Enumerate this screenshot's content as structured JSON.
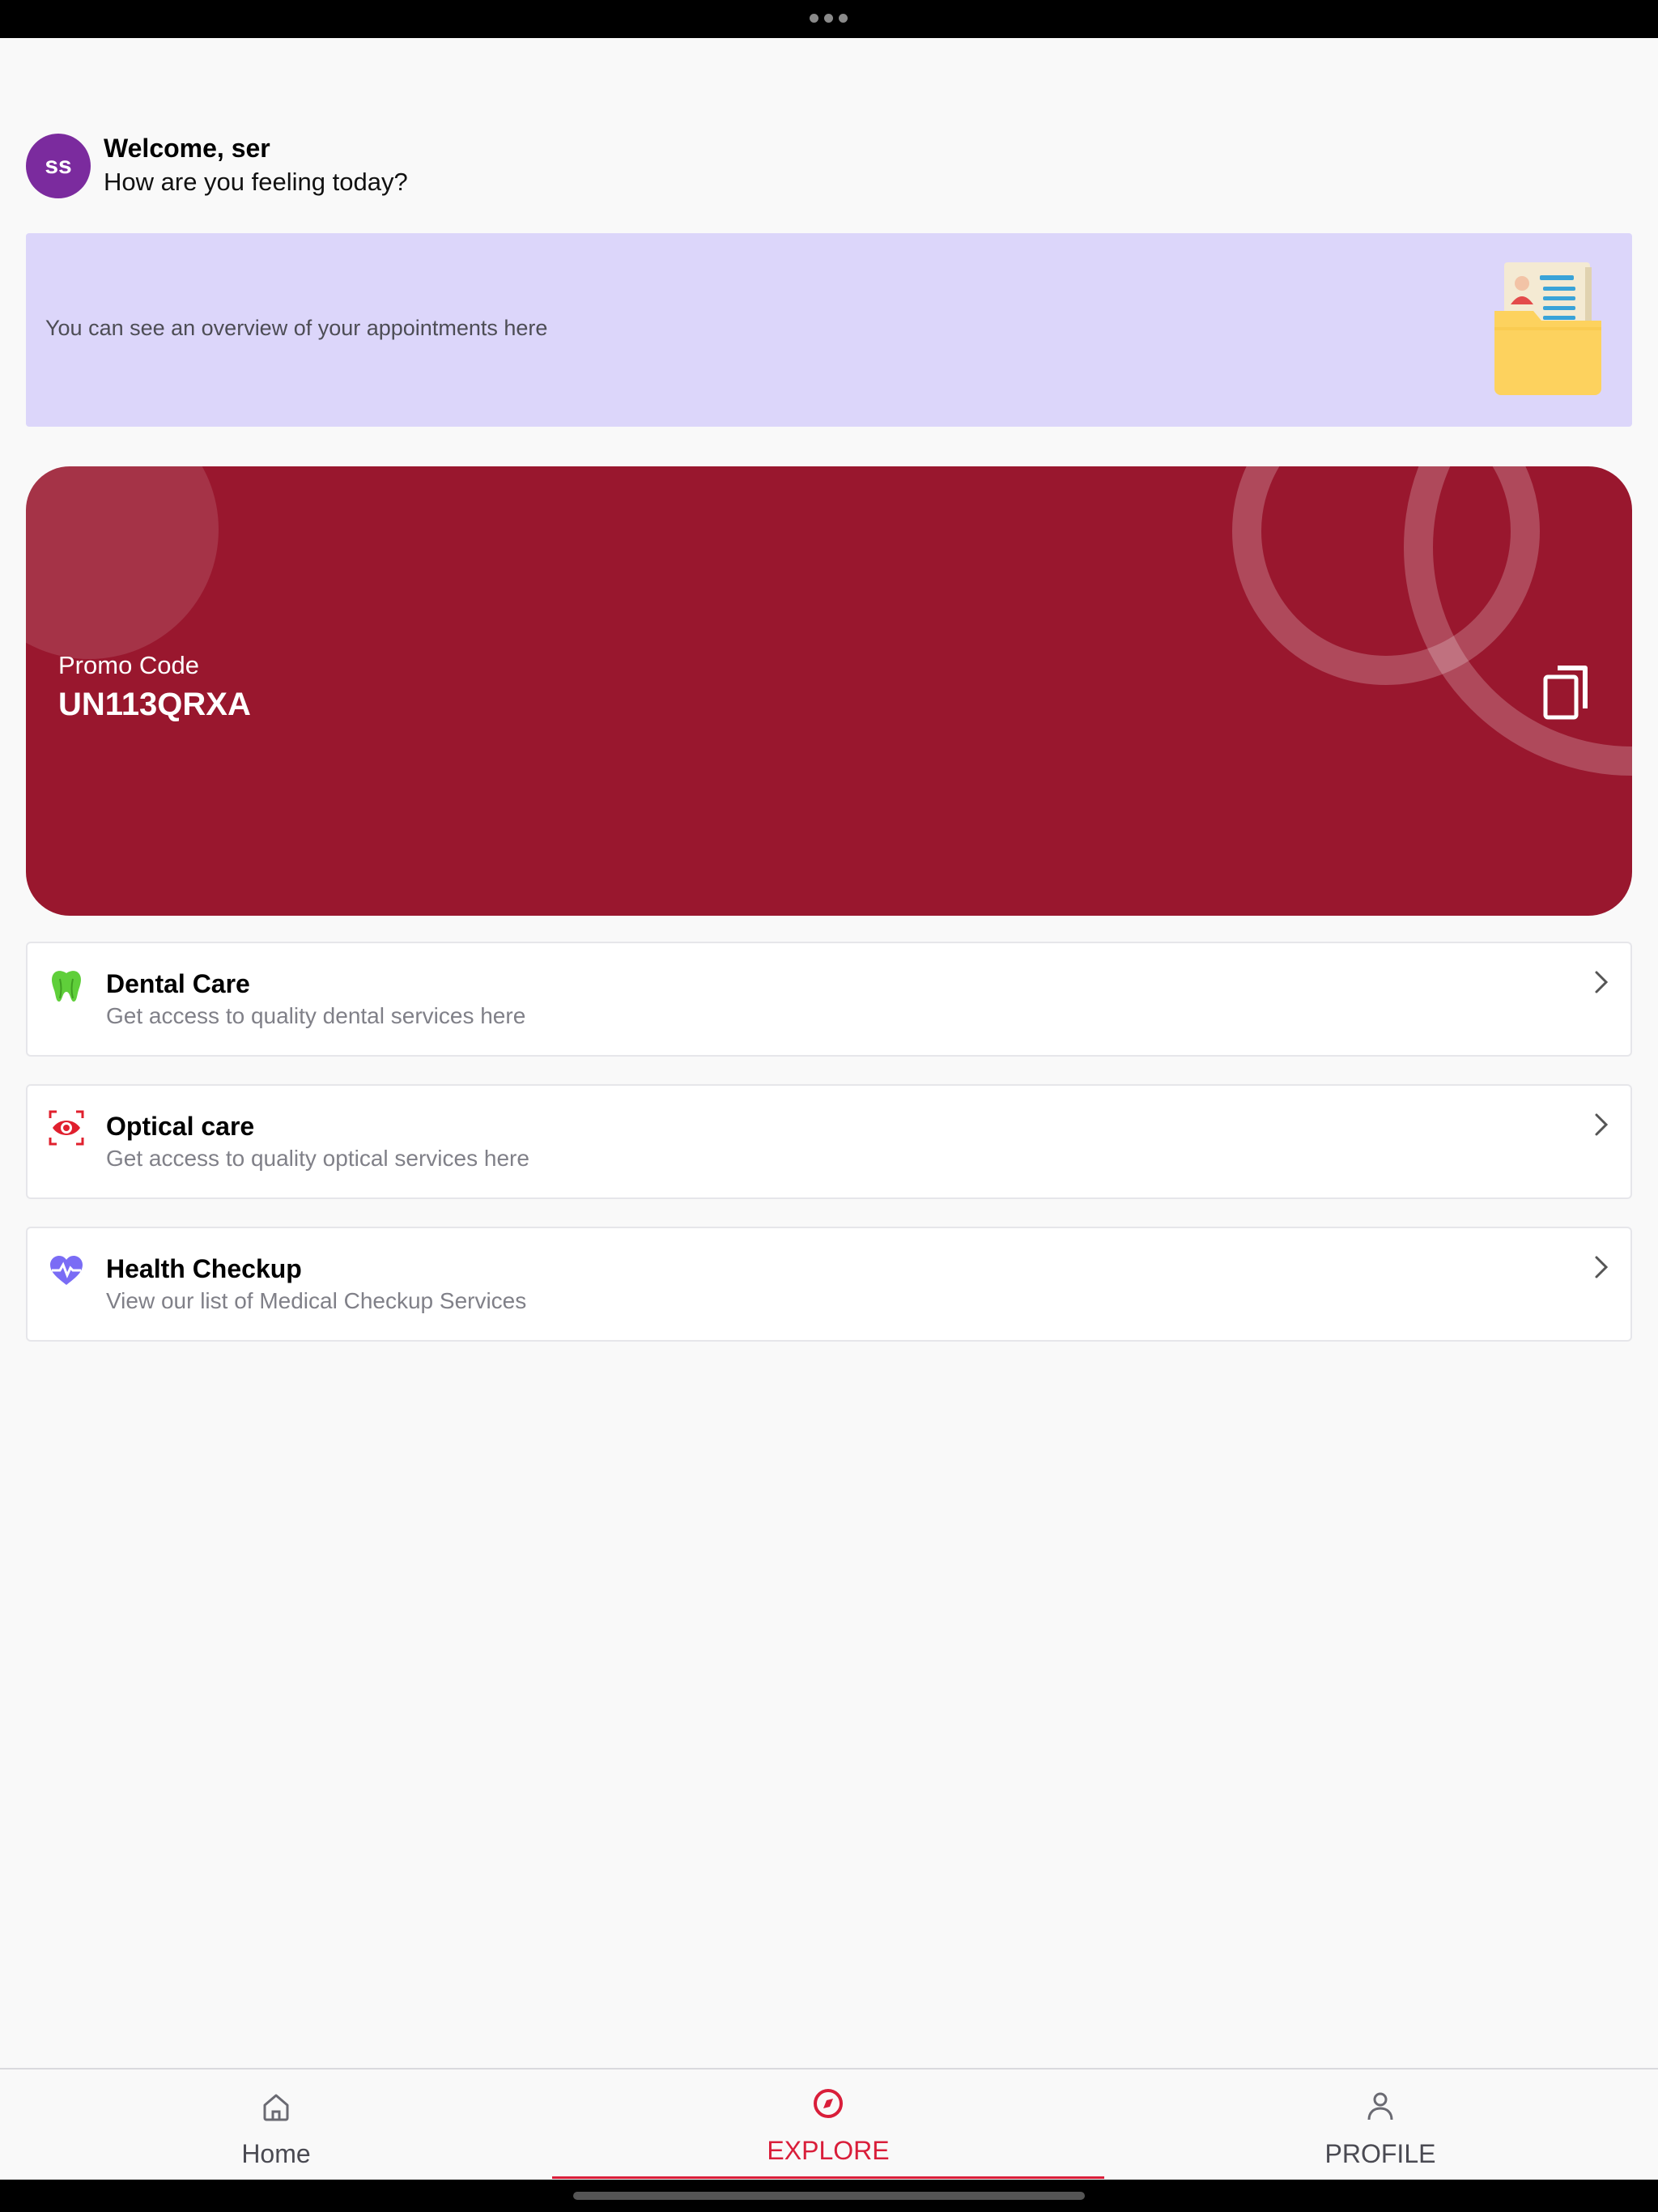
{
  "header": {
    "avatar_initials": "ss",
    "avatar_color": "#7b2b9e",
    "welcome": "Welcome, ser",
    "subtitle": "How are you feeling today?"
  },
  "banner": {
    "text": "You can see an overview of your appointments here",
    "illustration": "folder-document-icon",
    "background": "#dcd6fa"
  },
  "promo": {
    "label": "Promo Code",
    "code": "UN113QRXA",
    "background": "#99172e",
    "copy_icon": "copy-icon"
  },
  "services": [
    {
      "title": "Dental Care",
      "subtitle": "Get access to quality dental services here",
      "icon": "tooth-icon",
      "icon_color": "#5fcf3a"
    },
    {
      "title": "Optical care",
      "subtitle": "Get access to quality optical services here",
      "icon": "eye-icon",
      "icon_color": "#e0202e"
    },
    {
      "title": "Health Checkup",
      "subtitle": "View our list of Medical Checkup Services",
      "icon": "heart-pulse-icon",
      "icon_color": "#7a6cf5"
    }
  ],
  "tabs": [
    {
      "label": "Home",
      "icon": "home-icon",
      "active": false
    },
    {
      "label": "EXPLORE",
      "icon": "compass-icon",
      "active": true
    },
    {
      "label": "PROFILE",
      "icon": "user-icon",
      "active": false
    }
  ],
  "accent_color": "#d91e3a"
}
